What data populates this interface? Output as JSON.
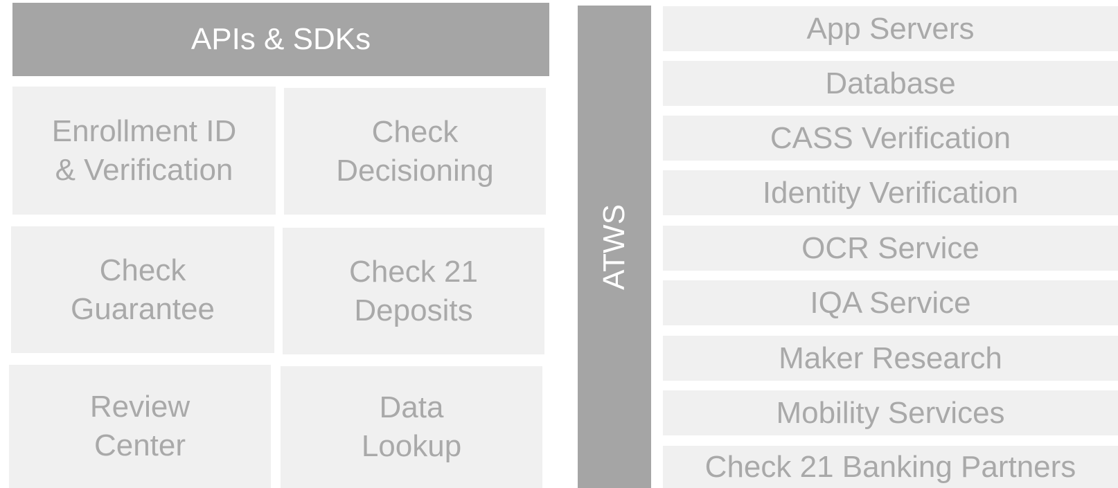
{
  "header": {
    "label": "APIs & SDKs"
  },
  "tiles": [
    {
      "label": "Enrollment ID\n& Verification"
    },
    {
      "label": "Check\nDecisioning"
    },
    {
      "label": "Check\nGuarantee"
    },
    {
      "label": "Check 21\nDeposits"
    },
    {
      "label": "Review\nCenter"
    },
    {
      "label": "Data\nLookup"
    }
  ],
  "vertical_bar": {
    "label": "ATWS"
  },
  "services": [
    {
      "label": "App Servers"
    },
    {
      "label": "Database"
    },
    {
      "label": "CASS Verification"
    },
    {
      "label": "Identity Verification"
    },
    {
      "label": "OCR Service"
    },
    {
      "label": "IQA Service"
    },
    {
      "label": "Maker Research"
    },
    {
      "label": "Mobility Services"
    },
    {
      "label": "Check 21 Banking Partners"
    }
  ]
}
